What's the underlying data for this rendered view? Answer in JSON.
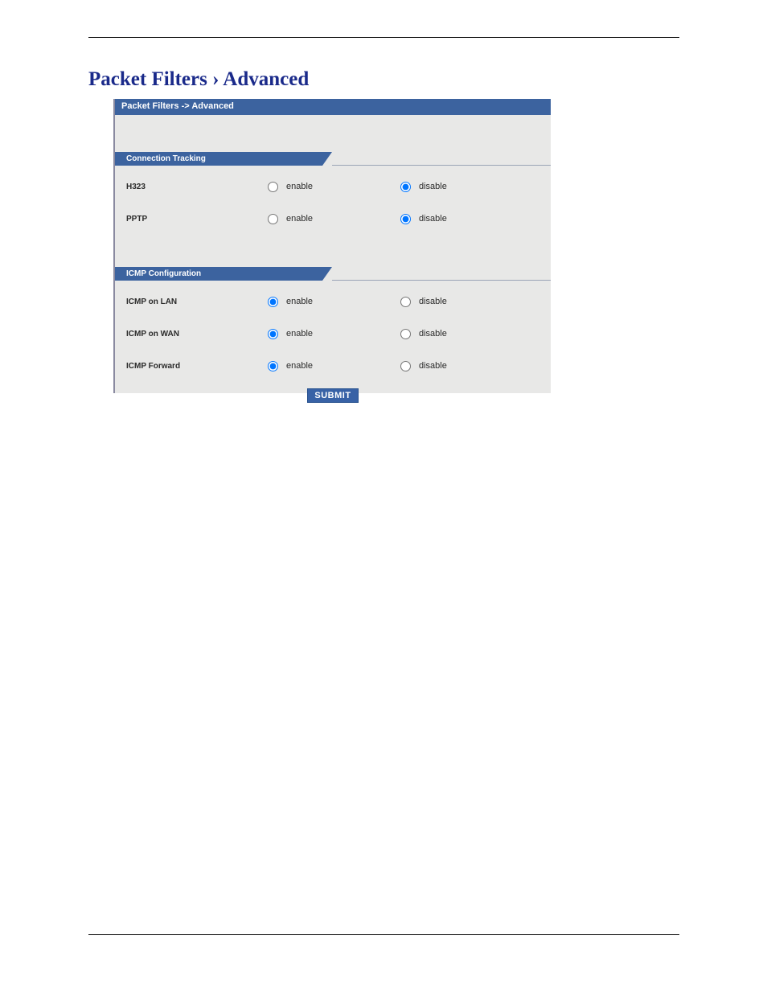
{
  "page_title": "Packet Filters › Advanced",
  "panel": {
    "breadcrumb": "Packet Filters  ->  Advanced",
    "sections": {
      "conn_tracking": {
        "header": "Connection Tracking",
        "rows": {
          "h323": {
            "label": "H323",
            "enable_label": "enable",
            "disable_label": "disable",
            "value": "disable"
          },
          "pptp": {
            "label": "PPTP",
            "enable_label": "enable",
            "disable_label": "disable",
            "value": "disable"
          }
        }
      },
      "icmp_config": {
        "header": "ICMP Configuration",
        "rows": {
          "icmp_lan": {
            "label": "ICMP on LAN",
            "enable_label": "enable",
            "disable_label": "disable",
            "value": "enable"
          },
          "icmp_wan": {
            "label": "ICMP on WAN",
            "enable_label": "enable",
            "disable_label": "disable",
            "value": "enable"
          },
          "icmp_forward": {
            "label": "ICMP Forward",
            "enable_label": "enable",
            "disable_label": "disable",
            "value": "enable"
          }
        }
      }
    },
    "submit_label": "SUBMIT"
  }
}
